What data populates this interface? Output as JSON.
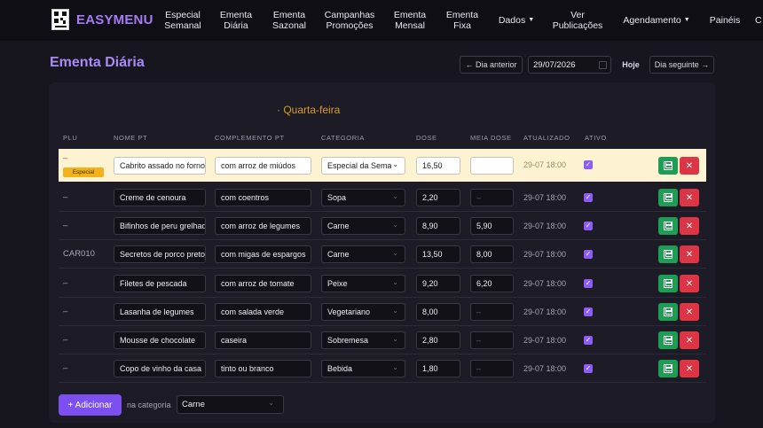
{
  "brand": {
    "name": "EASYMENU"
  },
  "nav": {
    "especial_semanal": [
      "Especial",
      "Semanal"
    ],
    "ementa_diaria": [
      "Ementa",
      "Diária"
    ],
    "ementa_sazonal": [
      "Ementa",
      "Sazonal"
    ],
    "campanhas": [
      "Campanhas",
      "Promoções"
    ],
    "ementa_mensal": [
      "Ementa",
      "Mensal"
    ],
    "ementa_fixa": [
      "Ementa",
      "Fixa"
    ],
    "dados": "Dados",
    "ver_publicacoes": [
      "Ver",
      "Publicações"
    ],
    "agendamento": "Agendamento",
    "paineis": "Painéis",
    "more": "C"
  },
  "header": {
    "title": "Ementa Diária",
    "prev_day": "← Dia anterior",
    "date": "29/07/2026",
    "today": "Hoje",
    "next_day": "Dia seguinte →"
  },
  "day_label": "· Quarta-feira",
  "columns": {
    "plu": "PLU",
    "nome": "NOME PT",
    "complemento": "COMPLEMENTO PT",
    "categoria": "CATEGORIA",
    "dose": "DOSE",
    "meia_dose": "MEIA DOSE",
    "atualizado": "ATUALIZADO",
    "ativo": "ATIVO"
  },
  "rows": [
    {
      "plu": "–",
      "badge": "Especial",
      "nome": "Cabrito assado no forno",
      "complemento": "com arroz de miúdos",
      "categoria": "Especial da Semana",
      "dose": "16,50",
      "meia_dose": "",
      "atualizado": "29-07 18:00",
      "ativo": true
    },
    {
      "plu": "–",
      "nome": "Creme de cenoura",
      "complemento": "com coentros",
      "categoria": "Sopa",
      "dose": "2,20",
      "meia_dose": "–",
      "atualizado": "29-07 18:00",
      "ativo": true
    },
    {
      "plu": "–",
      "nome": "Bifinhos de peru grelhados",
      "complemento": "com arroz de legumes",
      "categoria": "Carne",
      "dose": "8,90",
      "meia_dose": "5,90",
      "atualizado": "29-07 18:00",
      "ativo": true
    },
    {
      "plu": "CAR010",
      "nome": "Secretos de porco preto",
      "complemento": "com migas de espargos",
      "categoria": "Carne",
      "dose": "13,50",
      "meia_dose": "8,00",
      "atualizado": "29-07 18:00",
      "ativo": true
    },
    {
      "plu": "–",
      "nome": "Filetes de pescada",
      "complemento": "com arroz de tomate",
      "categoria": "Peixe",
      "dose": "9,20",
      "meia_dose": "6,20",
      "atualizado": "29-07 18:00",
      "ativo": true
    },
    {
      "plu": "–",
      "nome": "Lasanha de legumes",
      "complemento": "com salada verde",
      "categoria": "Vegetariano",
      "dose": "8,00",
      "meia_dose": "–",
      "atualizado": "29-07 18:00",
      "ativo": true
    },
    {
      "plu": "–",
      "nome": "Mousse de chocolate",
      "complemento": "caseira",
      "categoria": "Sobremesa",
      "dose": "2,80",
      "meia_dose": "–",
      "atualizado": "29-07 18:00",
      "ativo": true
    },
    {
      "plu": "–",
      "nome": "Copo de vinho da casa",
      "complemento": "tinto ou branco",
      "categoria": "Bebida",
      "dose": "1,80",
      "meia_dose": "–",
      "atualizado": "29-07 18:00",
      "ativo": true
    }
  ],
  "footer": {
    "add_label": "+ Adicionar",
    "category_label": "na categoria",
    "category_value": "Carne"
  },
  "colors": {
    "accent": "#7c4ff0",
    "title": "#a98bf7",
    "day": "#d99b2b",
    "save": "#1f9d55",
    "delete": "#dc3545",
    "special_row": "#fdf3d3"
  }
}
